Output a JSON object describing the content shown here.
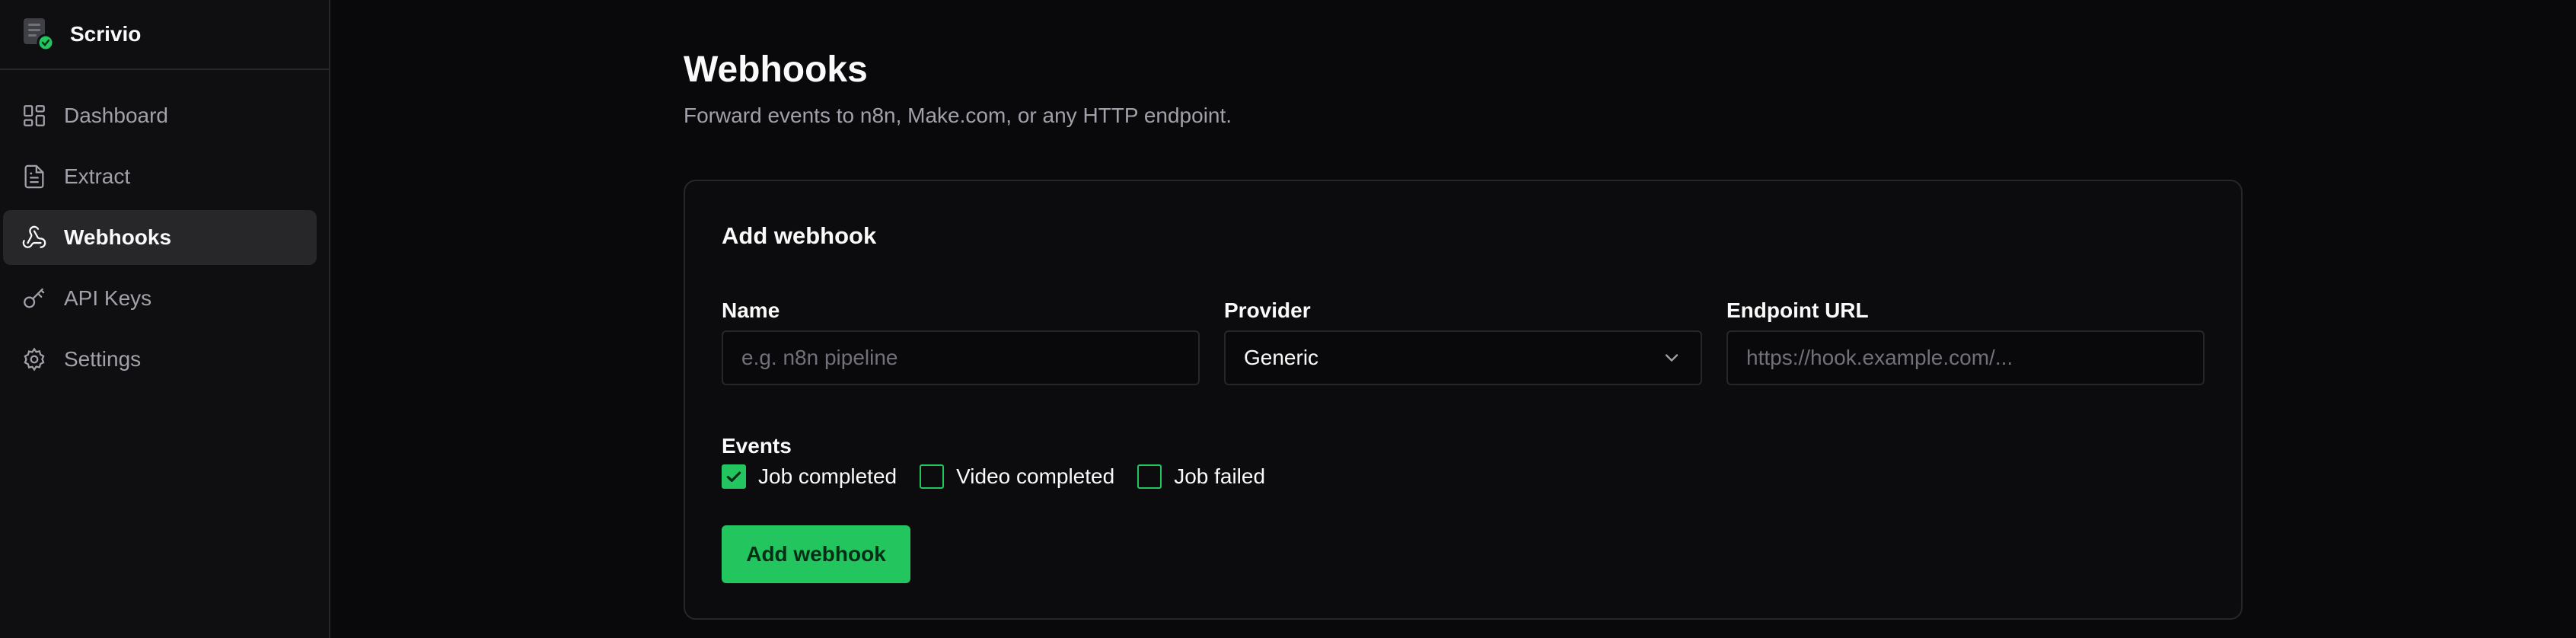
{
  "app": {
    "name": "Scrivio"
  },
  "sidebar": {
    "items": [
      {
        "label": "Dashboard",
        "icon": "dashboard-icon",
        "active": false
      },
      {
        "label": "Extract",
        "icon": "file-text-icon",
        "active": false
      },
      {
        "label": "Webhooks",
        "icon": "webhook-icon",
        "active": true
      },
      {
        "label": "API Keys",
        "icon": "key-icon",
        "active": false
      },
      {
        "label": "Settings",
        "icon": "gear-icon",
        "active": false
      }
    ]
  },
  "page": {
    "title": "Webhooks",
    "subtitle": "Forward events to n8n, Make.com, or any HTTP endpoint."
  },
  "form": {
    "title": "Add webhook",
    "name": {
      "label": "Name",
      "placeholder": "e.g. n8n pipeline",
      "value": ""
    },
    "provider": {
      "label": "Provider",
      "value": "Generic"
    },
    "endpoint": {
      "label": "Endpoint URL",
      "placeholder": "https://hook.example.com/...",
      "value": ""
    },
    "events": {
      "label": "Events",
      "options": [
        {
          "label": "Job completed",
          "checked": true
        },
        {
          "label": "Video completed",
          "checked": false
        },
        {
          "label": "Job failed",
          "checked": false
        }
      ]
    },
    "submit_label": "Add webhook"
  },
  "colors": {
    "accent": "#22c55e",
    "background": "#09090b",
    "sidebar": "#0f0f11",
    "border": "#27272a",
    "muted_text": "#a1a1aa"
  }
}
